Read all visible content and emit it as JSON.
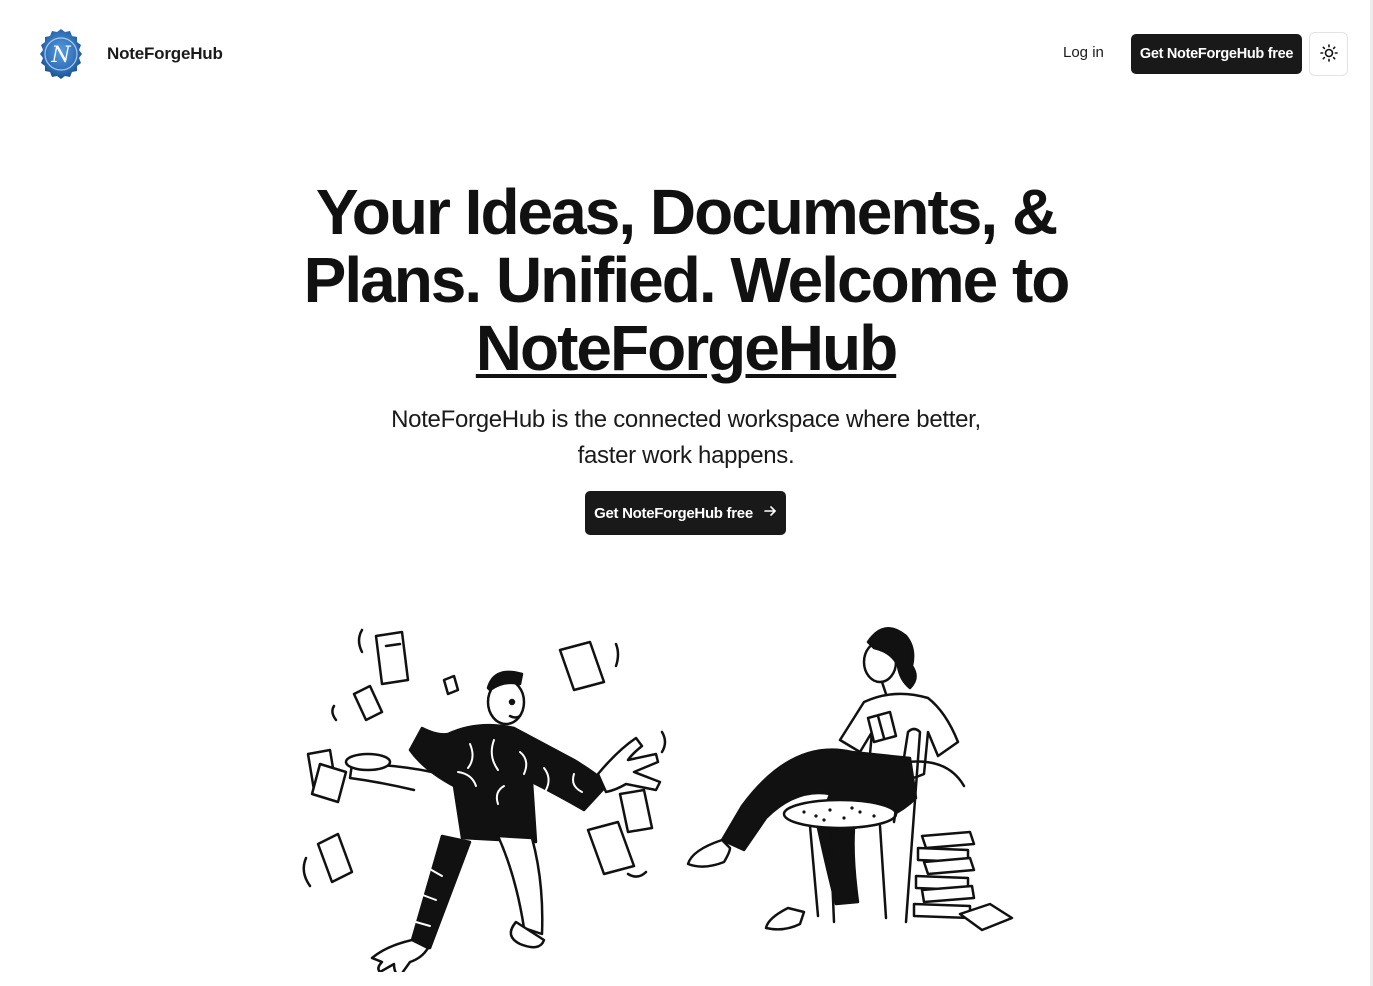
{
  "header": {
    "brand": "NoteForgeHub",
    "logo_letter": "N",
    "login_label": "Log in",
    "cta_label": "Get NoteForgeHub free",
    "theme_icon": "sun-icon"
  },
  "hero": {
    "title_part1": "Your Ideas, Documents, & Plans. Unified. Welcome to ",
    "title_brand": "NoteForgeHub",
    "subtitle": "NoteForgeHub is the connected workspace where better, faster work happens.",
    "cta_label": "Get NoteForgeHub free",
    "cta_icon": "arrow-right-icon"
  },
  "illustrations": {
    "left": "juggling-papers-illustration",
    "right": "reading-person-illustration"
  },
  "colors": {
    "primary": "#191919",
    "background": "#ffffff",
    "logo_blue": "#2f6fb5"
  }
}
